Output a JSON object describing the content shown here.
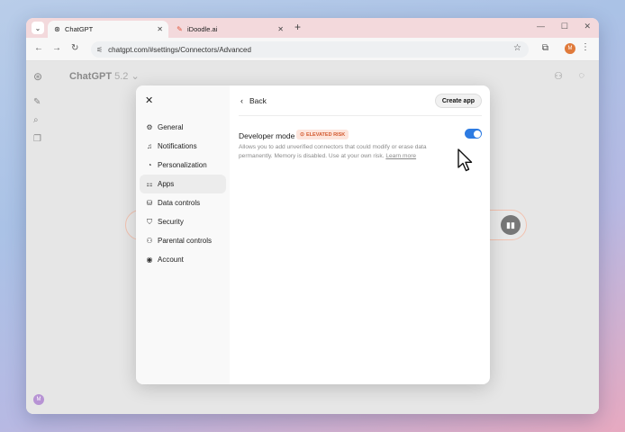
{
  "browser": {
    "tabs": [
      {
        "label": "ChatGPT",
        "active": true
      },
      {
        "label": "iDoodle.ai",
        "active": false
      }
    ],
    "new_tab": "+",
    "url": "chatgpt.com/#settings/Connectors/Advanced",
    "profile_initial": "M",
    "window_controls": [
      "—",
      "☐",
      "✕"
    ]
  },
  "chat": {
    "model_name": "ChatGPT",
    "model_version": "5.2",
    "avatar_initial": "M"
  },
  "settings": {
    "nav": [
      {
        "label": "General",
        "icon": "gear-icon",
        "glyph": "⚙"
      },
      {
        "label": "Notifications",
        "icon": "bell-icon",
        "glyph": "🔔"
      },
      {
        "label": "Personalization",
        "icon": "personalization-icon",
        "glyph": "◔"
      },
      {
        "label": "Apps",
        "icon": "apps-grid-icon",
        "glyph": "⁘"
      },
      {
        "label": "Data controls",
        "icon": "database-icon",
        "glyph": "⛁"
      },
      {
        "label": "Security",
        "icon": "shield-icon",
        "glyph": "⛉"
      },
      {
        "label": "Parental controls",
        "icon": "family-icon",
        "glyph": "⚇"
      },
      {
        "label": "Account",
        "icon": "account-icon",
        "glyph": "◉"
      }
    ],
    "selected_nav": "Apps",
    "back_label": "Back",
    "create_app_label": "Create app",
    "developer_mode": {
      "title": "Developer mode",
      "badge": "ELEVATED RISK",
      "description": "Allows you to add unverified connectors that could modify or erase data permanently. Memory is disabled. Use at your own risk.",
      "learn_more": "Learn more",
      "enabled": true
    }
  },
  "colors": {
    "accent": "#2d7be2",
    "badge_text": "#d35a30",
    "badge_bg": "#fde5dc",
    "profile": "#e07a3b"
  }
}
